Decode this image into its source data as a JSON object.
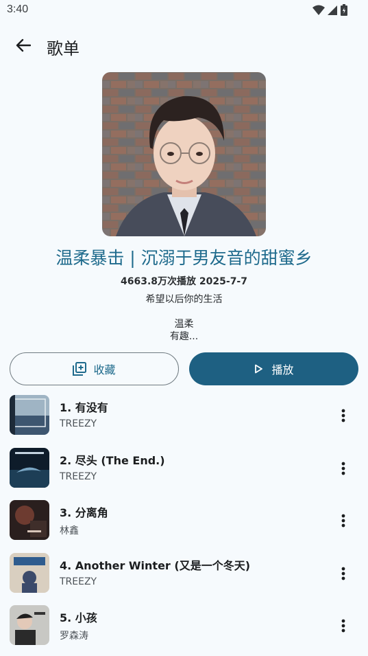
{
  "status_bar": {
    "time": "3:40"
  },
  "app_bar": {
    "title": "歌单"
  },
  "playlist": {
    "title": "温柔暴击 | 沉溺于男友音的甜蜜乡",
    "meta": "4663.8万次播放 2025-7-7",
    "subtitle": "希望以后你的生活",
    "desc_line1": "温柔",
    "desc_line2": "有趣..."
  },
  "actions": {
    "favorite_label": "收藏",
    "play_label": "播放"
  },
  "tracks": [
    {
      "title": "1. 有没有",
      "artist": "TREEZY"
    },
    {
      "title": "2. 尽头 (The End.)",
      "artist": "TREEZY"
    },
    {
      "title": "3. 分离角",
      "artist": "林鑫"
    },
    {
      "title": "4. Another Winter (又是一个冬天)",
      "artist": "TREEZY"
    },
    {
      "title": "5. 小孩",
      "artist": "罗森涛"
    }
  ],
  "colors": {
    "accent": "#1e6a8c",
    "play_button": "#1e6082",
    "background": "#f6fafd"
  }
}
